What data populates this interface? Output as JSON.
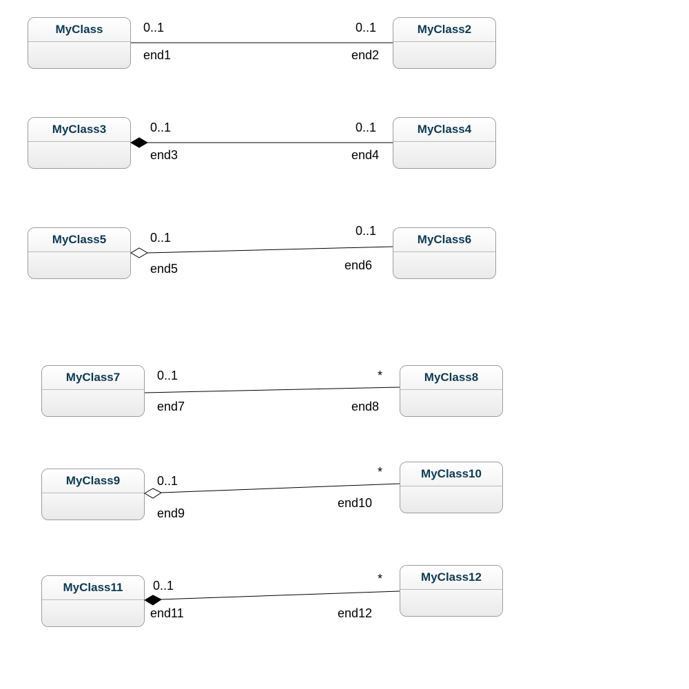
{
  "chart_data": {
    "type": "uml-class-diagram",
    "associations": [
      {
        "left": "MyClass",
        "right": "MyClass2",
        "left_end": "end1",
        "right_end": "end2",
        "left_mult": "0..1",
        "right_mult": "0..1",
        "decoration": "none"
      },
      {
        "left": "MyClass3",
        "right": "MyClass4",
        "left_end": "end3",
        "right_end": "end4",
        "left_mult": "0..1",
        "right_mult": "0..1",
        "decoration": "composition"
      },
      {
        "left": "MyClass5",
        "right": "MyClass6",
        "left_end": "end5",
        "right_end": "end6",
        "left_mult": "0..1",
        "right_mult": "0..1",
        "decoration": "aggregation"
      },
      {
        "left": "MyClass7",
        "right": "MyClass8",
        "left_end": "end7",
        "right_end": "end8",
        "left_mult": "0..1",
        "right_mult": "*",
        "decoration": "none"
      },
      {
        "left": "MyClass9",
        "right": "MyClass10",
        "left_end": "end9",
        "right_end": "end10",
        "left_mult": "0..1",
        "right_mult": "*",
        "decoration": "aggregation"
      },
      {
        "left": "MyClass11",
        "right": "MyClass12",
        "left_end": "end11",
        "right_end": "end12",
        "left_mult": "0..1",
        "right_mult": "*",
        "decoration": "composition"
      }
    ]
  },
  "rows": [
    {
      "left_name": "MyClass",
      "right_name": "MyClass2",
      "left_mult": "0..1",
      "right_mult": "0..1",
      "left_end": "end1",
      "right_end": "end2"
    },
    {
      "left_name": "MyClass3",
      "right_name": "MyClass4",
      "left_mult": "0..1",
      "right_mult": "0..1",
      "left_end": "end3",
      "right_end": "end4"
    },
    {
      "left_name": "MyClass5",
      "right_name": "MyClass6",
      "left_mult": "0..1",
      "right_mult": "0..1",
      "left_end": "end5",
      "right_end": "end6"
    },
    {
      "left_name": "MyClass7",
      "right_name": "MyClass8",
      "left_mult": "0..1",
      "right_mult": "*",
      "left_end": "end7",
      "right_end": "end8"
    },
    {
      "left_name": "MyClass9",
      "right_name": "MyClass10",
      "left_mult": "0..1",
      "right_mult": "*",
      "left_end": "end9",
      "right_end": "end10"
    },
    {
      "left_name": "MyClass11",
      "right_name": "MyClass12",
      "left_mult": "0..1",
      "right_mult": "*",
      "left_end": "end11",
      "right_end": "end12"
    }
  ]
}
